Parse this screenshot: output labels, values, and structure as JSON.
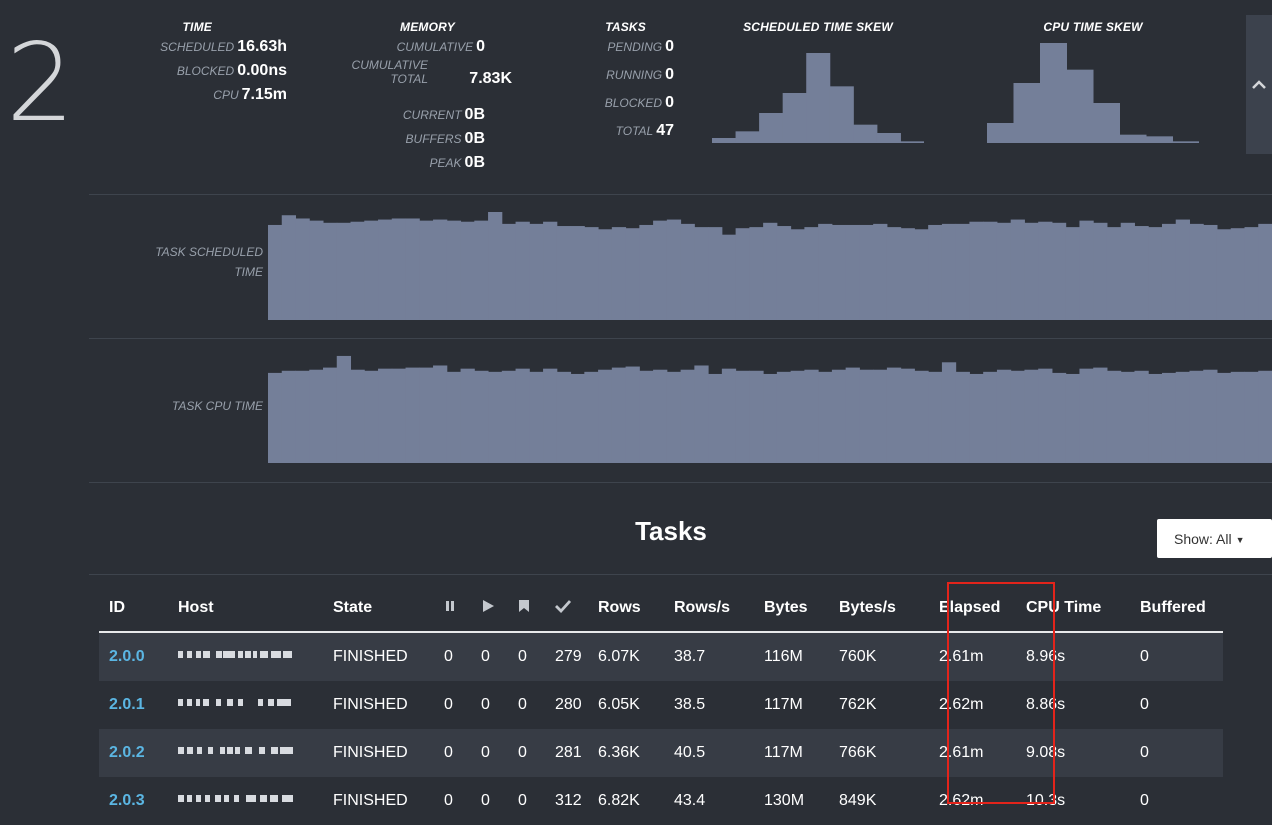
{
  "stage": {
    "number": "2"
  },
  "time": {
    "title": "TIME",
    "rows": [
      {
        "label": "SCHEDULED",
        "value": "16.63h"
      },
      {
        "label": "BLOCKED",
        "value": "0.00ns"
      },
      {
        "label": "CPU",
        "value": "7.15m"
      }
    ]
  },
  "memory": {
    "title": "MEMORY",
    "cumulative_label": "CUMULATIVE",
    "cumulative_value": "0",
    "cumulative_total_label_1": "CUMULATIVE",
    "cumulative_total_label_2": "TOTAL",
    "cumulative_total_value": "7.83K",
    "current_label": "CURRENT",
    "current_value": "0B",
    "buffers_label": "BUFFERS",
    "buffers_value": "0B",
    "peak_label": "PEAK",
    "peak_value": "0B"
  },
  "tasks_summary": {
    "title": "TASKS",
    "rows": [
      {
        "label": "PENDING",
        "value": "0"
      },
      {
        "label": "RUNNING",
        "value": "0"
      },
      {
        "label": "BLOCKED",
        "value": "0"
      },
      {
        "label": "TOTAL",
        "value": "47"
      }
    ]
  },
  "skew": {
    "scheduled_title": "SCHEDULED TIME SKEW",
    "cpu_title": "CPU TIME SKEW",
    "scheduled_bins": [
      3,
      7,
      18,
      30,
      54,
      34,
      11,
      6,
      1
    ],
    "cpu_bins": [
      12,
      36,
      60,
      44,
      24,
      5,
      4,
      1
    ],
    "bar_color": "#747f99"
  },
  "collapse": {
    "icon": "chevron-up-icon"
  },
  "sparklines": {
    "scheduled_label_1": "TASK SCHEDULED",
    "scheduled_label_2": "TIME",
    "cpu_label": "TASK CPU TIME",
    "color": "#747f99",
    "scheduled_values": [
      88,
      97,
      94,
      92,
      90,
      90,
      91,
      92,
      93,
      94,
      94,
      92,
      93,
      92,
      91,
      92,
      100,
      89,
      91,
      89,
      91,
      87,
      87,
      86,
      84,
      86,
      85,
      88,
      92,
      93,
      89,
      86,
      86,
      79,
      85,
      86,
      90,
      87,
      84,
      86,
      89,
      88,
      88,
      88,
      89,
      86,
      85,
      84,
      88,
      89,
      89,
      91,
      91,
      90,
      93,
      90,
      91,
      90,
      86,
      92,
      90,
      86,
      90,
      87,
      86,
      89,
      93,
      89,
      88,
      84,
      85,
      86,
      89
    ],
    "cpu_values": [
      85,
      87,
      87,
      88,
      90,
      101,
      88,
      87,
      89,
      89,
      90,
      90,
      92,
      86,
      89,
      87,
      86,
      87,
      89,
      86,
      89,
      86,
      84,
      86,
      88,
      90,
      91,
      87,
      88,
      86,
      88,
      92,
      84,
      89,
      87,
      87,
      84,
      86,
      87,
      88,
      86,
      88,
      90,
      88,
      88,
      90,
      89,
      87,
      86,
      95,
      86,
      84,
      86,
      88,
      87,
      88,
      89,
      85,
      84,
      89,
      90,
      87,
      86,
      87,
      84,
      85,
      86,
      87,
      88,
      85,
      86,
      86,
      87
    ]
  },
  "tasks": {
    "title": "Tasks",
    "show_label": "Show: All",
    "columns": {
      "id": "ID",
      "host": "Host",
      "state": "State",
      "pause_icon": "pause-icon",
      "play_icon": "play-icon",
      "bookmark_icon": "bookmark-icon",
      "check_icon": "check-icon",
      "rows": "Rows",
      "rows_per_s": "Rows/s",
      "bytes": "Bytes",
      "bytes_per_s": "Bytes/s",
      "elapsed": "Elapsed",
      "cpu_time": "CPU Time",
      "buffered": "Buffered"
    },
    "items": [
      {
        "id": "2.0.0",
        "state": "FINISHED",
        "c1": "0",
        "c2": "0",
        "c3": "0",
        "c4": "279",
        "rows": "6.07K",
        "rows_s": "38.7",
        "bytes": "116M",
        "bytes_s": "760K",
        "elapsed": "2.61m",
        "cpu": "8.96s",
        "buffered": "0"
      },
      {
        "id": "2.0.1",
        "state": "FINISHED",
        "c1": "0",
        "c2": "0",
        "c3": "0",
        "c4": "280",
        "rows": "6.05K",
        "rows_s": "38.5",
        "bytes": "117M",
        "bytes_s": "762K",
        "elapsed": "2.62m",
        "cpu": "8.86s",
        "buffered": "0"
      },
      {
        "id": "2.0.2",
        "state": "FINISHED",
        "c1": "0",
        "c2": "0",
        "c3": "0",
        "c4": "281",
        "rows": "6.36K",
        "rows_s": "40.5",
        "bytes": "117M",
        "bytes_s": "766K",
        "elapsed": "2.61m",
        "cpu": "9.08s",
        "buffered": "0"
      },
      {
        "id": "2.0.3",
        "state": "FINISHED",
        "c1": "0",
        "c2": "0",
        "c3": "0",
        "c4": "312",
        "rows": "6.82K",
        "rows_s": "43.4",
        "bytes": "130M",
        "bytes_s": "849K",
        "elapsed": "2.62m",
        "cpu": "10.3s",
        "buffered": "0"
      }
    ]
  },
  "highlight": {
    "color": "#e3241b"
  }
}
